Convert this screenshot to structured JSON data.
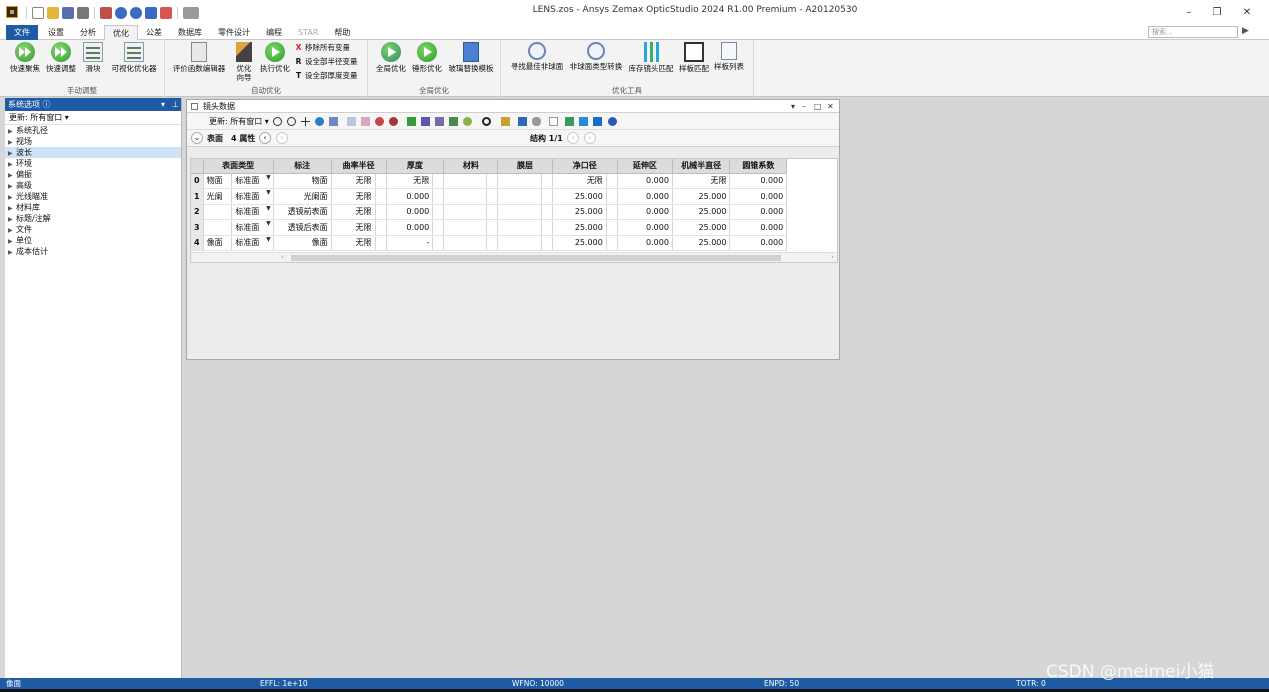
{
  "window": {
    "title": "LENS.zos - Ansys Zemax OpticStudio 2024 R1.00   Premium - A20120530"
  },
  "window_controls": {
    "minimize": "–",
    "restore": "❐",
    "close": "✕"
  },
  "ribbon_tabs": [
    "文件",
    "设置",
    "分析",
    "优化",
    "公差",
    "数据库",
    "零件设计",
    "编程",
    "STAR",
    "帮助"
  ],
  "active_tab": "优化",
  "search": {
    "placeholder": "搜索..."
  },
  "ribbon": {
    "manual": {
      "label": "手动调整",
      "quick_focus": "快速聚焦",
      "quick_adjust": "快速调整",
      "slider": "滑块",
      "visual_optimizer": "可视化优化器"
    },
    "auto": {
      "label": "自动优化",
      "merit_editor": "评价函数编辑器",
      "wizard_line1": "优化",
      "wizard_line2": "向导",
      "run": "执行优化",
      "remove_vars": "移除所有变量",
      "set_radius_vars": "设全部半径变量",
      "set_thickness_vars": "设全部厚度变量",
      "x_mark": "X",
      "r_mark": "R",
      "t_mark": "T"
    },
    "global": {
      "label": "全局优化",
      "global_opt": "全局优化",
      "hammer": "锤形优化",
      "glass_sub": "玻璃替换模板"
    },
    "tools": {
      "label": "优化工具",
      "best_asphere": "寻找最佳非球面",
      "asphere_convert": "非球面类型转换",
      "stock_lens": "库存镜头匹配",
      "test_plate": "样板匹配",
      "test_plate_list": "样板列表"
    }
  },
  "left_panel": {
    "title": "系统选项 ⓘ",
    "update": "更新: 所有窗口 ▾",
    "items": [
      "系统孔径",
      "视场",
      "波长",
      "环境",
      "偏振",
      "高级",
      "光线瞄准",
      "材料库",
      "标题/注解",
      "文件",
      "单位",
      "成本估计"
    ],
    "selected_index": 2
  },
  "lde": {
    "title": "镜头数据",
    "update": "更新: 所有窗口 ▾",
    "surface_label": "表面",
    "props": "4 属性",
    "config": "结构 1/1",
    "columns": [
      "表面类型",
      "标注",
      "曲率半径",
      "厚度",
      "材料",
      "膜层",
      "净口径",
      "延伸区",
      "机械半直径",
      "圆锥系数"
    ],
    "rows": [
      {
        "num": "0",
        "name": "物面",
        "type": "标准面",
        "comment": "物面",
        "radius": "无限",
        "thickness": "无限",
        "material": "",
        "coating": "",
        "clear": "无限",
        "chip": "0.000",
        "mech": "无限",
        "conic": "0.000"
      },
      {
        "num": "1",
        "name": "光阑",
        "type": "标准面",
        "comment": "光阑面",
        "radius": "无限",
        "thickness": "0.000",
        "material": "",
        "coating": "",
        "clear": "25.000",
        "chip": "0.000",
        "mech": "25.000",
        "conic": "0.000"
      },
      {
        "num": "2",
        "name": "",
        "type": "标准面",
        "comment": "透镜前表面",
        "radius": "无限",
        "thickness": "0.000",
        "material": "",
        "coating": "",
        "clear": "25.000",
        "chip": "0.000",
        "mech": "25.000",
        "conic": "0.000"
      },
      {
        "num": "3",
        "name": "",
        "type": "标准面",
        "comment": "透镜后表面",
        "radius": "无限",
        "thickness": "0.000",
        "material": "",
        "coating": "",
        "clear": "25.000",
        "chip": "0.000",
        "mech": "25.000",
        "conic": "0.000"
      },
      {
        "num": "4",
        "name": "像面",
        "type": "标准面",
        "comment": "像面",
        "radius": "无限",
        "thickness": "-",
        "material": "",
        "coating": "",
        "clear": "25.000",
        "chip": "0.000",
        "mech": "25.000",
        "conic": "0.000"
      }
    ]
  },
  "status": {
    "left": "像面",
    "effl": "EFFL: 1e+10",
    "wfno": "WFNO: 10000",
    "enpd": "ENPD: 50",
    "totr": "TOTR: 0"
  },
  "watermark": "CSDN @meimei小猫",
  "colors": {
    "accent": "#1f5aa5",
    "ribbon_bg": "#f3f3f3",
    "workspace": "#d5d6d8"
  }
}
